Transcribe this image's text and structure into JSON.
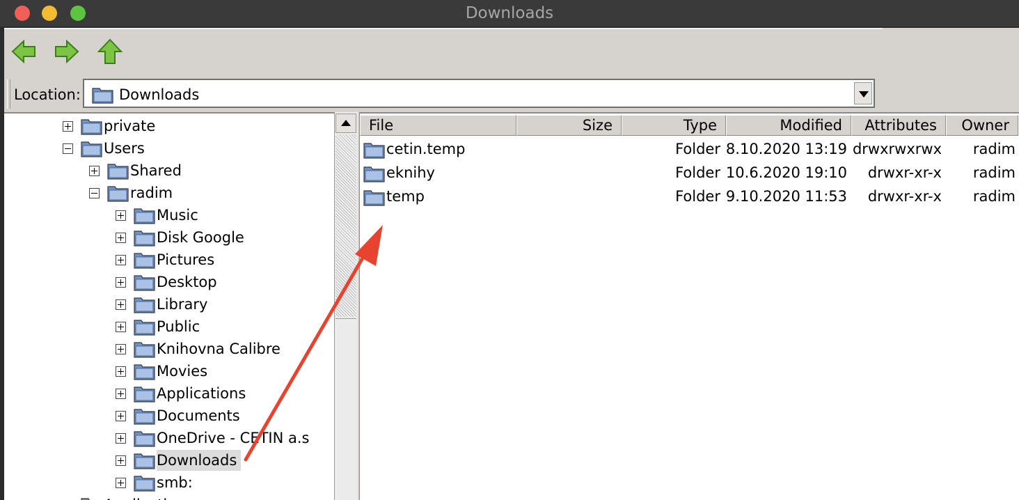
{
  "window": {
    "title": "Downloads"
  },
  "toolbar": {
    "back_icon": "back-arrow-icon",
    "forward_icon": "forward-arrow-icon",
    "up_icon": "up-arrow-icon"
  },
  "location": {
    "label": "Location:",
    "value": "Downloads"
  },
  "tree": {
    "items": [
      {
        "label": "private",
        "state": "collapsed"
      },
      {
        "label": "Users",
        "state": "expanded"
      },
      {
        "label": "Shared",
        "state": "collapsed"
      },
      {
        "label": "radim",
        "state": "expanded"
      },
      {
        "label": "Music",
        "state": "collapsed"
      },
      {
        "label": "Disk Google",
        "state": "collapsed"
      },
      {
        "label": "Pictures",
        "state": "collapsed"
      },
      {
        "label": "Desktop",
        "state": "collapsed"
      },
      {
        "label": "Library",
        "state": "collapsed"
      },
      {
        "label": "Public",
        "state": "collapsed"
      },
      {
        "label": "Knihovna Calibre",
        "state": "collapsed"
      },
      {
        "label": "Movies",
        "state": "collapsed"
      },
      {
        "label": "Applications",
        "state": "collapsed"
      },
      {
        "label": "Documents",
        "state": "collapsed"
      },
      {
        "label": "OneDrive - CETIN a.s",
        "state": "collapsed"
      },
      {
        "label": "Downloads",
        "state": "collapsed",
        "selected": true
      },
      {
        "label": "smb:",
        "state": "collapsed"
      },
      {
        "label": "Applications",
        "state": "collapsed"
      }
    ]
  },
  "files": {
    "columns": [
      "File",
      "Size",
      "Type",
      "Modified",
      "Attributes",
      "Owner"
    ],
    "rows": [
      {
        "name": "cetin.temp",
        "size": "",
        "type": "Folder",
        "modified": "8.10.2020 13:19",
        "attributes": "drwxrwxrwx",
        "owner": "radim"
      },
      {
        "name": "eknihy",
        "size": "",
        "type": "Folder",
        "modified": "10.6.2020 19:10",
        "attributes": "drwxr-xr-x",
        "owner": "radim"
      },
      {
        "name": "temp",
        "size": "",
        "type": "Folder",
        "modified": "9.10.2020 11:53",
        "attributes": "drwxr-xr-x",
        "owner": "radim"
      }
    ]
  },
  "colors": {
    "annotation_arrow": "#e8432f",
    "folder_fill": "#6f93c8",
    "window_bg": "#d6d3ce"
  }
}
